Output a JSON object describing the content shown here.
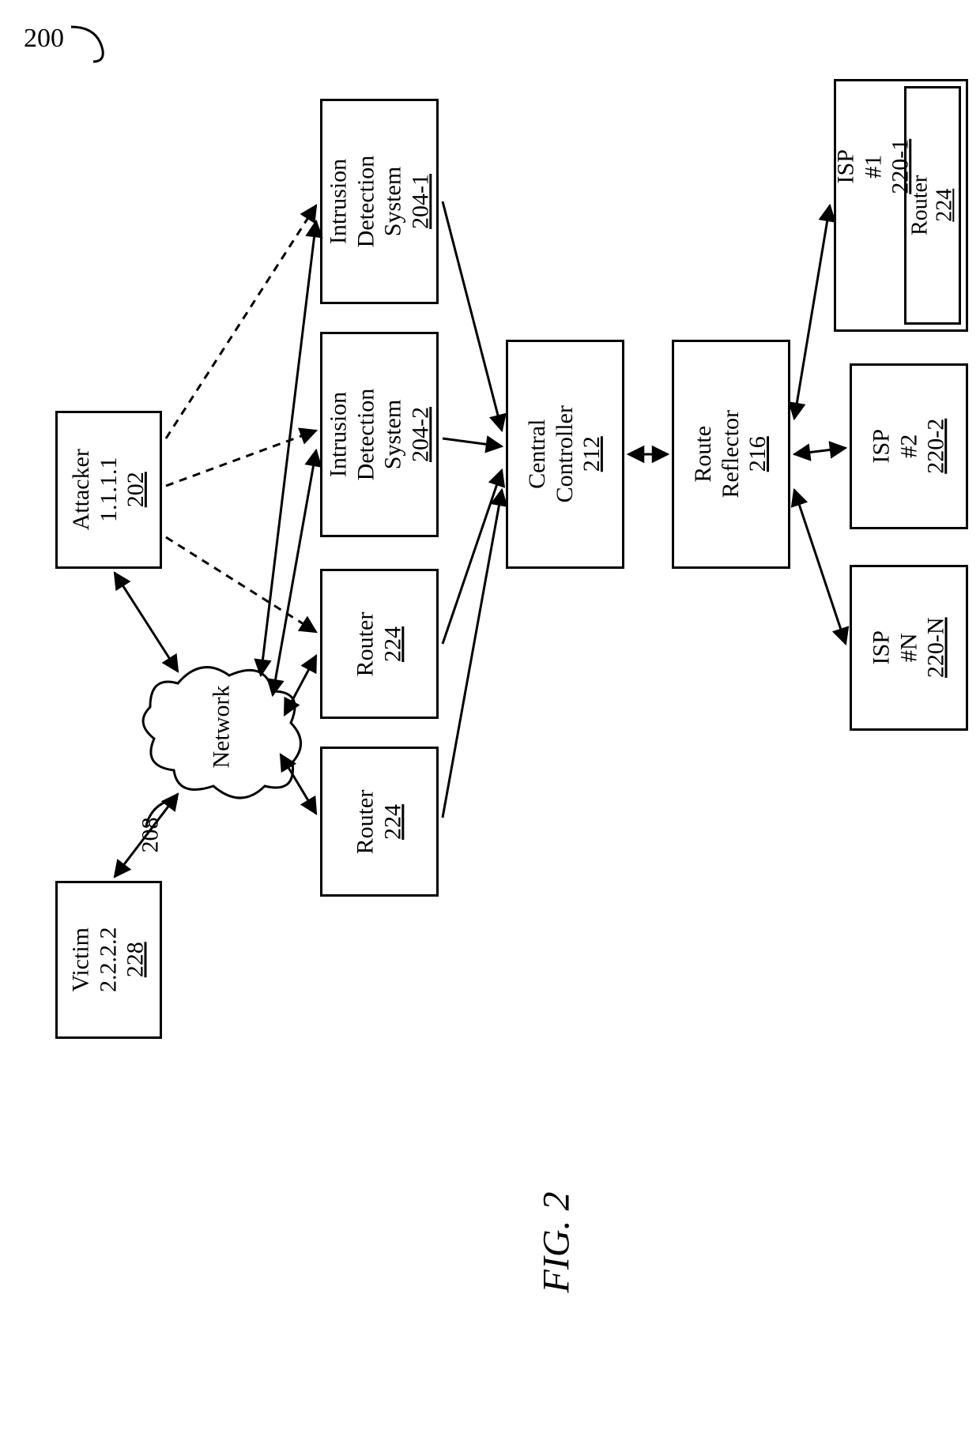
{
  "figure_number_label": "200",
  "figure_caption": "FIG. 2",
  "attacker": {
    "title": "Attacker",
    "ip": "1.1.1.1",
    "ref": "202"
  },
  "victim": {
    "title": "Victim",
    "ip": "2.2.2.2",
    "ref": "228"
  },
  "network": {
    "title": "Network",
    "ref": "208"
  },
  "ids1": {
    "line1": "Intrusion",
    "line2": "Detection",
    "line3": "System",
    "ref": "204-1"
  },
  "ids2": {
    "line1": "Intrusion",
    "line2": "Detection",
    "line3": "System",
    "ref": "204-2"
  },
  "router1": {
    "title": "Router",
    "ref": "224"
  },
  "router2": {
    "title": "Router",
    "ref": "224"
  },
  "central": {
    "line1": "Central",
    "line2": "Controller",
    "ref": "212"
  },
  "reflector": {
    "line1": "Route",
    "line2": "Reflector",
    "ref": "216"
  },
  "isp1": {
    "line1": "ISP",
    "line2": "#1",
    "ref": "220-1",
    "inner_title": "Router",
    "inner_ref": "224"
  },
  "isp2": {
    "line1": "ISP",
    "line2": "#2",
    "ref": "220-2"
  },
  "ispn": {
    "line1": "ISP",
    "line2": "#N",
    "ref": "220-N"
  }
}
